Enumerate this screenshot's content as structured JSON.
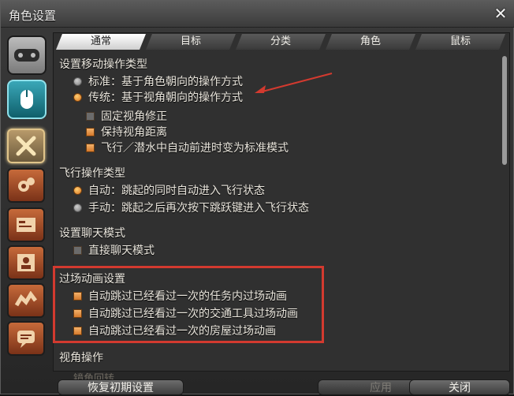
{
  "window": {
    "title": "角色设置",
    "close_icon": "close-icon"
  },
  "tabs": [
    "通常",
    "目标",
    "分类",
    "角色",
    "鼠标"
  ],
  "sections": {
    "move_type": {
      "title": "设置移动操作类型",
      "options": [
        {
          "label": "标准：基于角色朝向的操作方式",
          "selected": false
        },
        {
          "label": "传统：基于视角朝向的操作方式",
          "selected": true
        }
      ],
      "checks": [
        {
          "label": "固定视角修正",
          "checked": false
        },
        {
          "label": "保持视角距离",
          "checked": true
        },
        {
          "label": "飞行／潜水中自动前进时变为标准模式",
          "checked": true
        }
      ]
    },
    "flight_type": {
      "title": "飞行操作类型",
      "options": [
        {
          "label": "自动：跳起的同时自动进入飞行状态",
          "selected": true
        },
        {
          "label": "手动：跳起之后再次按下跳跃键进入飞行状态",
          "selected": false
        }
      ]
    },
    "chat_mode": {
      "title": "设置聊天模式",
      "checks": [
        {
          "label": "直接聊天模式",
          "checked": false
        }
      ]
    },
    "cutscene": {
      "title": "过场动画设置",
      "checks": [
        {
          "label": "自动跳过已经看过一次的任务内过场动画",
          "checked": true
        },
        {
          "label": "自动跳过已经看过一次的交通工具过场动画",
          "checked": true
        },
        {
          "label": "自动跳过已经看过一次的房屋过场动画",
          "checked": true
        }
      ]
    },
    "camera": {
      "title": "视角操作",
      "partial_label": "镜角回转"
    }
  },
  "buttons": {
    "reset": "恢复初期设置",
    "apply": "应用",
    "close": "关闭"
  },
  "colors": {
    "annotation_red": "#d33a2f",
    "option_on": "#e07a25"
  },
  "icons": {
    "gamepad": "gamepad-icon",
    "mouse": "mouse-icon",
    "cross_arrows": "crossed-arrows-icon",
    "gears": "gears-icon",
    "card": "id-card-icon",
    "profile": "profile-icon",
    "checkered": "checkered-icon",
    "chat": "chat-bubble-icon"
  }
}
